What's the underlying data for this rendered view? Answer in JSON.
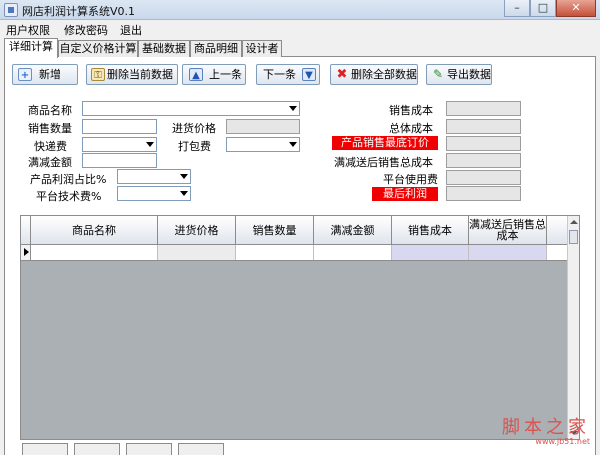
{
  "window": {
    "title": "网店利润计算系统V0.1",
    "min": "–",
    "max": "□",
    "close": "✕"
  },
  "menu": [
    "用户权限",
    "修改密码",
    "退出"
  ],
  "tabs": [
    "详细计算",
    "自定义价格计算",
    "基础数据",
    "商品明细",
    "设计者"
  ],
  "toolbar": {
    "add": "新增",
    "delete_current": "删除当前数据",
    "prev": "上一条",
    "next": "下一条",
    "delete_all": "删除全部数据",
    "export": "导出数据"
  },
  "icons": {
    "add": "plus-file-icon",
    "delete_current": "lock-delete-icon",
    "prev": "up-arrow-icon",
    "next": "down-arrow-icon",
    "delete_all": "red-x-icon",
    "export": "pencil-export-icon"
  },
  "form": {
    "product_name": "商品名称",
    "quantity": "销售数量",
    "purchase_price": "进货价格",
    "shipping_fee": "快递费",
    "packaging_fee": "打包费",
    "discount_amount": "满减金额",
    "profit_ratio": "产品利润占比%",
    "platform_fee": "平台技术费%",
    "sales_cost": "销售成本",
    "total_cost": "总体成本",
    "min_price": "产品销售最底订价",
    "discounted_total": "满减送后销售总成本",
    "platform_usage_fee": "平台使用费",
    "final_profit": "最后利润"
  },
  "grid": {
    "columns": [
      "商品名称",
      "进货价格",
      "销售数量",
      "满减金额",
      "销售成本",
      "满减送后销售总成本"
    ]
  },
  "watermark": {
    "title": "脚本之家",
    "url": "www.jb51.net"
  },
  "colors": {
    "alert_red": "#f00000",
    "field_border": "#7f9db9",
    "readonly_bg": "#e6e6e6"
  }
}
